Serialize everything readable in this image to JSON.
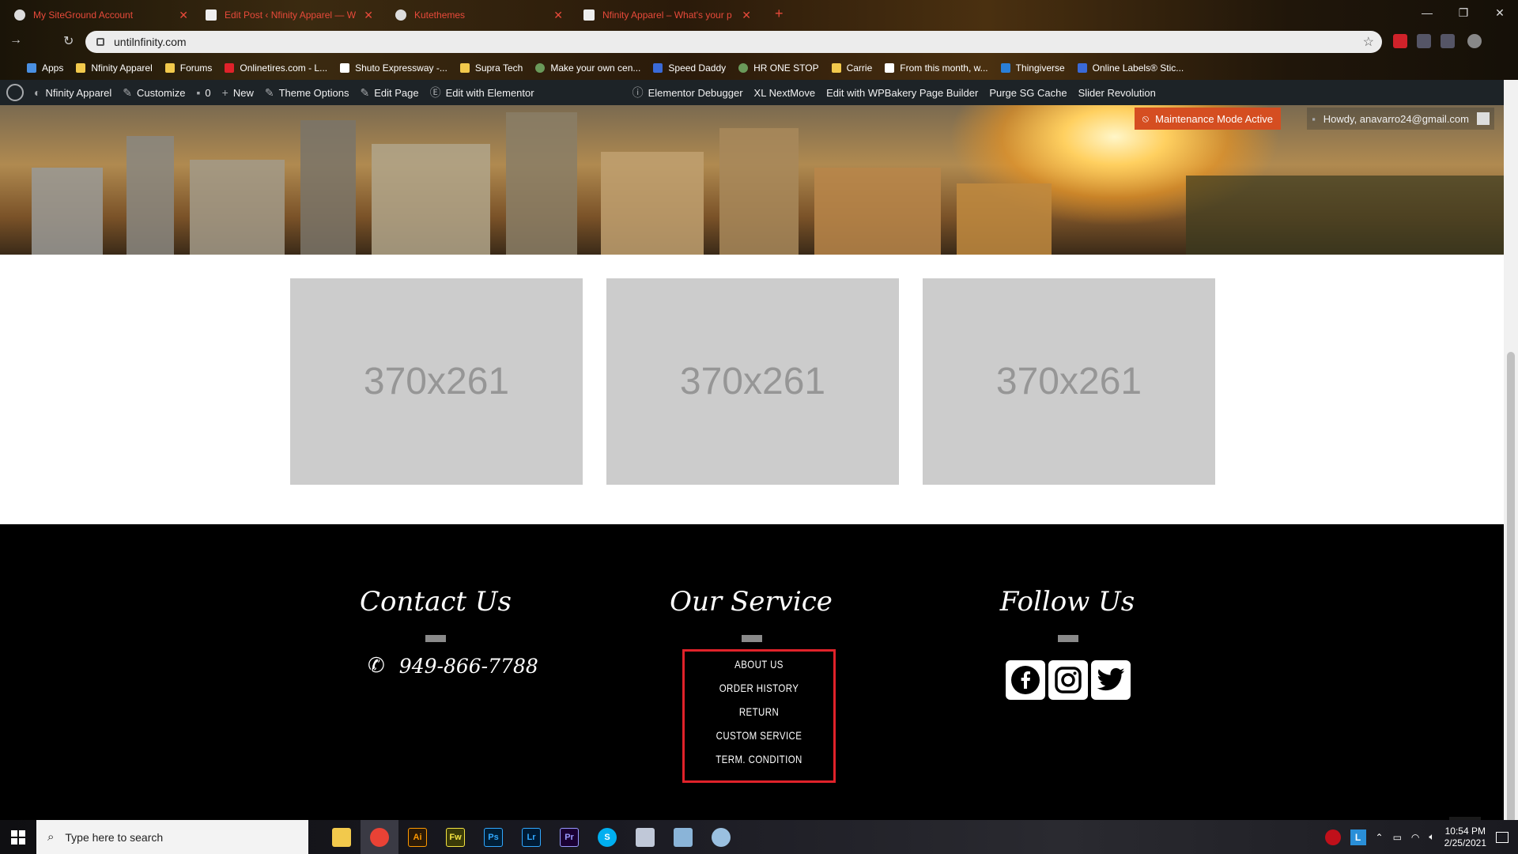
{
  "browser": {
    "tabs": [
      {
        "title": "My SiteGround Account"
      },
      {
        "title": "Edit Post ‹ Nfinity Apparel — W"
      },
      {
        "title": "Kutethemes"
      },
      {
        "title": "Nfinity Apparel – What's your p"
      }
    ],
    "new_tab": "+",
    "url": "untilnfinity.com",
    "bookmarks": [
      {
        "label": "Apps",
        "color": "#4a90e2"
      },
      {
        "label": "Nfinity Apparel",
        "color": "#f2c94c"
      },
      {
        "label": "Forums",
        "color": "#f2c94c"
      },
      {
        "label": "Onlinetires.com - L...",
        "color": "#e0222a"
      },
      {
        "label": "Shuto Expressway -...",
        "color": "#ffffff"
      },
      {
        "label": "Supra Tech",
        "color": "#f2c94c"
      },
      {
        "label": "Make your own cen...",
        "color": "#6a9a5a"
      },
      {
        "label": "Speed Daddy",
        "color": "#3a6ad8"
      },
      {
        "label": "HR ONE STOP",
        "color": "#6a9a5a"
      },
      {
        "label": "Carrie",
        "color": "#f2c94c"
      },
      {
        "label": "From this month, w...",
        "color": "#ffffff"
      },
      {
        "label": "Thingiverse",
        "color": "#2a7fd8"
      },
      {
        "label": "Online Labels® Stic...",
        "color": "#3a6ad8"
      }
    ]
  },
  "adminbar": {
    "site_name": "Nfinity Apparel",
    "customize": "Customize",
    "comments": "0",
    "new": "New",
    "theme_options": "Theme Options",
    "edit_page": "Edit Page",
    "edit_elementor": "Edit with Elementor",
    "debugger": "Elementor Debugger",
    "nextmove": "XL NextMove",
    "wpbakery": "Edit with WPBakery Page Builder",
    "purge": "Purge SG Cache",
    "slider": "Slider Revolution",
    "maintenance": "Maintenance Mode Active",
    "howdy": "Howdy, anavarro24@gmail.com"
  },
  "placeholders": [
    "370x261",
    "370x261",
    "370x261"
  ],
  "footer": {
    "contact": {
      "title": "Contact Us",
      "phone": "949-866-7788"
    },
    "service": {
      "title": "Our Service",
      "items": [
        "ABOUT US",
        "ORDER HISTORY",
        "RETURN",
        "CUSTOM SERVICE",
        "TERM. CONDITION"
      ]
    },
    "follow": {
      "title": "Follow Us",
      "networks": [
        "facebook",
        "instagram",
        "twitter"
      ]
    },
    "highlight_color": "#e0222a"
  },
  "taskbar": {
    "search_placeholder": "Type here to search",
    "apps": [
      {
        "name": "file-explorer",
        "label": "",
        "bg": "#f2c94c",
        "fg": "#000"
      },
      {
        "name": "chrome",
        "label": "",
        "bg": "#e94235",
        "fg": "#fff"
      },
      {
        "name": "illustrator",
        "label": "Ai",
        "bg": "#2b1a07",
        "fg": "#ff9a00"
      },
      {
        "name": "fireworks",
        "label": "Fw",
        "bg": "#3a3a08",
        "fg": "#f5e342"
      },
      {
        "name": "photoshop",
        "label": "Ps",
        "bg": "#001e36",
        "fg": "#31a8ff"
      },
      {
        "name": "lightroom",
        "label": "Lr",
        "bg": "#001a33",
        "fg": "#31a8ff"
      },
      {
        "name": "premiere",
        "label": "Pr",
        "bg": "#1a0033",
        "fg": "#9999ff"
      },
      {
        "name": "skype",
        "label": "S",
        "bg": "#00aff0",
        "fg": "#fff"
      },
      {
        "name": "media-app",
        "label": "",
        "bg": "#c0c8d8",
        "fg": "#000"
      },
      {
        "name": "notes-app",
        "label": "",
        "bg": "#8ab4d8",
        "fg": "#000"
      },
      {
        "name": "paint-app",
        "label": "",
        "bg": "#9ac0e0",
        "fg": "#000"
      }
    ],
    "time": "10:54 PM",
    "date": "2/25/2021"
  }
}
